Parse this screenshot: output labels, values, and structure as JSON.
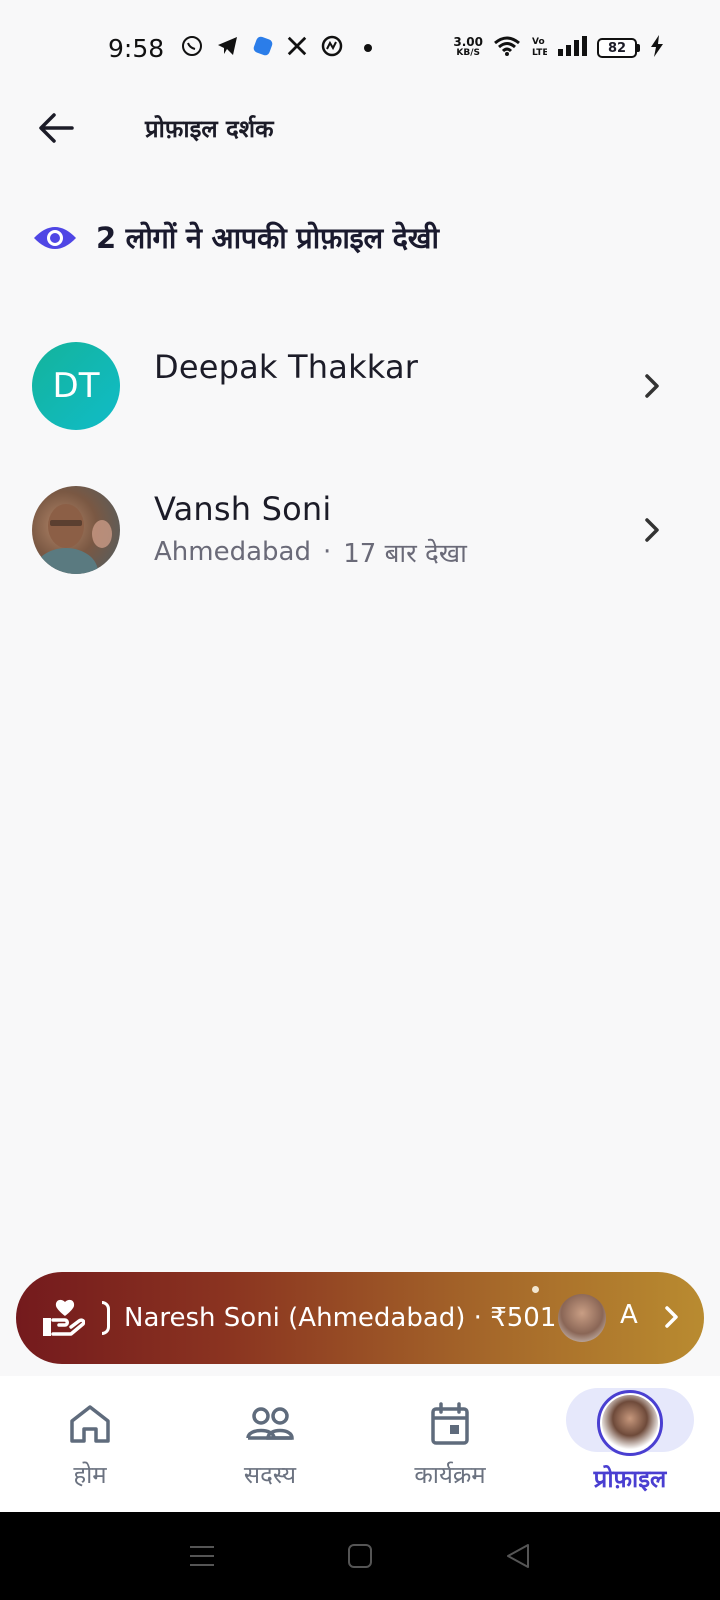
{
  "status_bar": {
    "time": "9:58",
    "net_speed": "3.00",
    "net_unit": "KB/S",
    "battery": "82"
  },
  "header": {
    "title": "प्रोफ़ाइल दर्शक"
  },
  "summary": {
    "text": "2 लोगों ने आपकी प्रोफ़ाइल देखी"
  },
  "viewers": [
    {
      "initials": "DT",
      "name": "Deepak Thakkar"
    },
    {
      "name": "Vansh Soni",
      "city": "Ahmedabad",
      "separator": "·",
      "views": "17 बार देखा"
    }
  ],
  "donation_banner": {
    "text": "Naresh Soni (Ahmedabad) · ₹501",
    "next_initial": "A"
  },
  "bottom_nav": {
    "items": [
      {
        "label": "होम",
        "icon": "home-icon"
      },
      {
        "label": "सदस्य",
        "icon": "members-icon"
      },
      {
        "label": "कार्यक्रम",
        "icon": "calendar-icon"
      },
      {
        "label": "प्रोफ़ाइल",
        "icon": "profile-avatar",
        "active": true
      }
    ]
  },
  "colors": {
    "accent": "#4a3fd1",
    "initials_avatar": "#14b39b",
    "banner_start": "#741a1d",
    "banner_end": "#b98b30"
  }
}
